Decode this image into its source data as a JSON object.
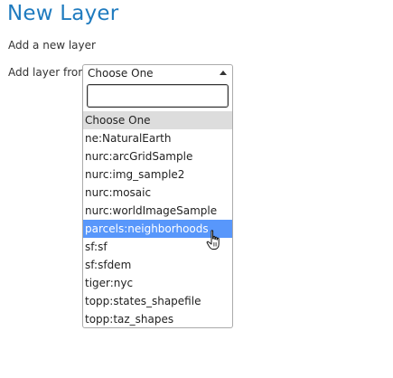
{
  "page": {
    "title": "New Layer",
    "subtitle": "Add a new layer"
  },
  "form": {
    "add_layer_label": "Add layer from",
    "select": {
      "selected_value": "Choose One",
      "search_value": "",
      "options": [
        "Choose One",
        "ne:NaturalEarth",
        "nurc:arcGridSample",
        "nurc:img_sample2",
        "nurc:mosaic",
        "nurc:worldImageSample",
        "parcels:neighborhoods",
        "sf:sf",
        "sf:sfdem",
        "tiger:nyc",
        "topp:states_shapefile",
        "topp:taz_shapes"
      ],
      "highlighted_option": "parcels:neighborhoods"
    }
  },
  "colors": {
    "title": "#1f7bbf",
    "highlight": "#5897fb",
    "selected_option_bg": "#dddddd"
  },
  "icons": {
    "dropdown_arrow": "triangle-up-icon",
    "cursor": "hand-pointer-icon"
  }
}
